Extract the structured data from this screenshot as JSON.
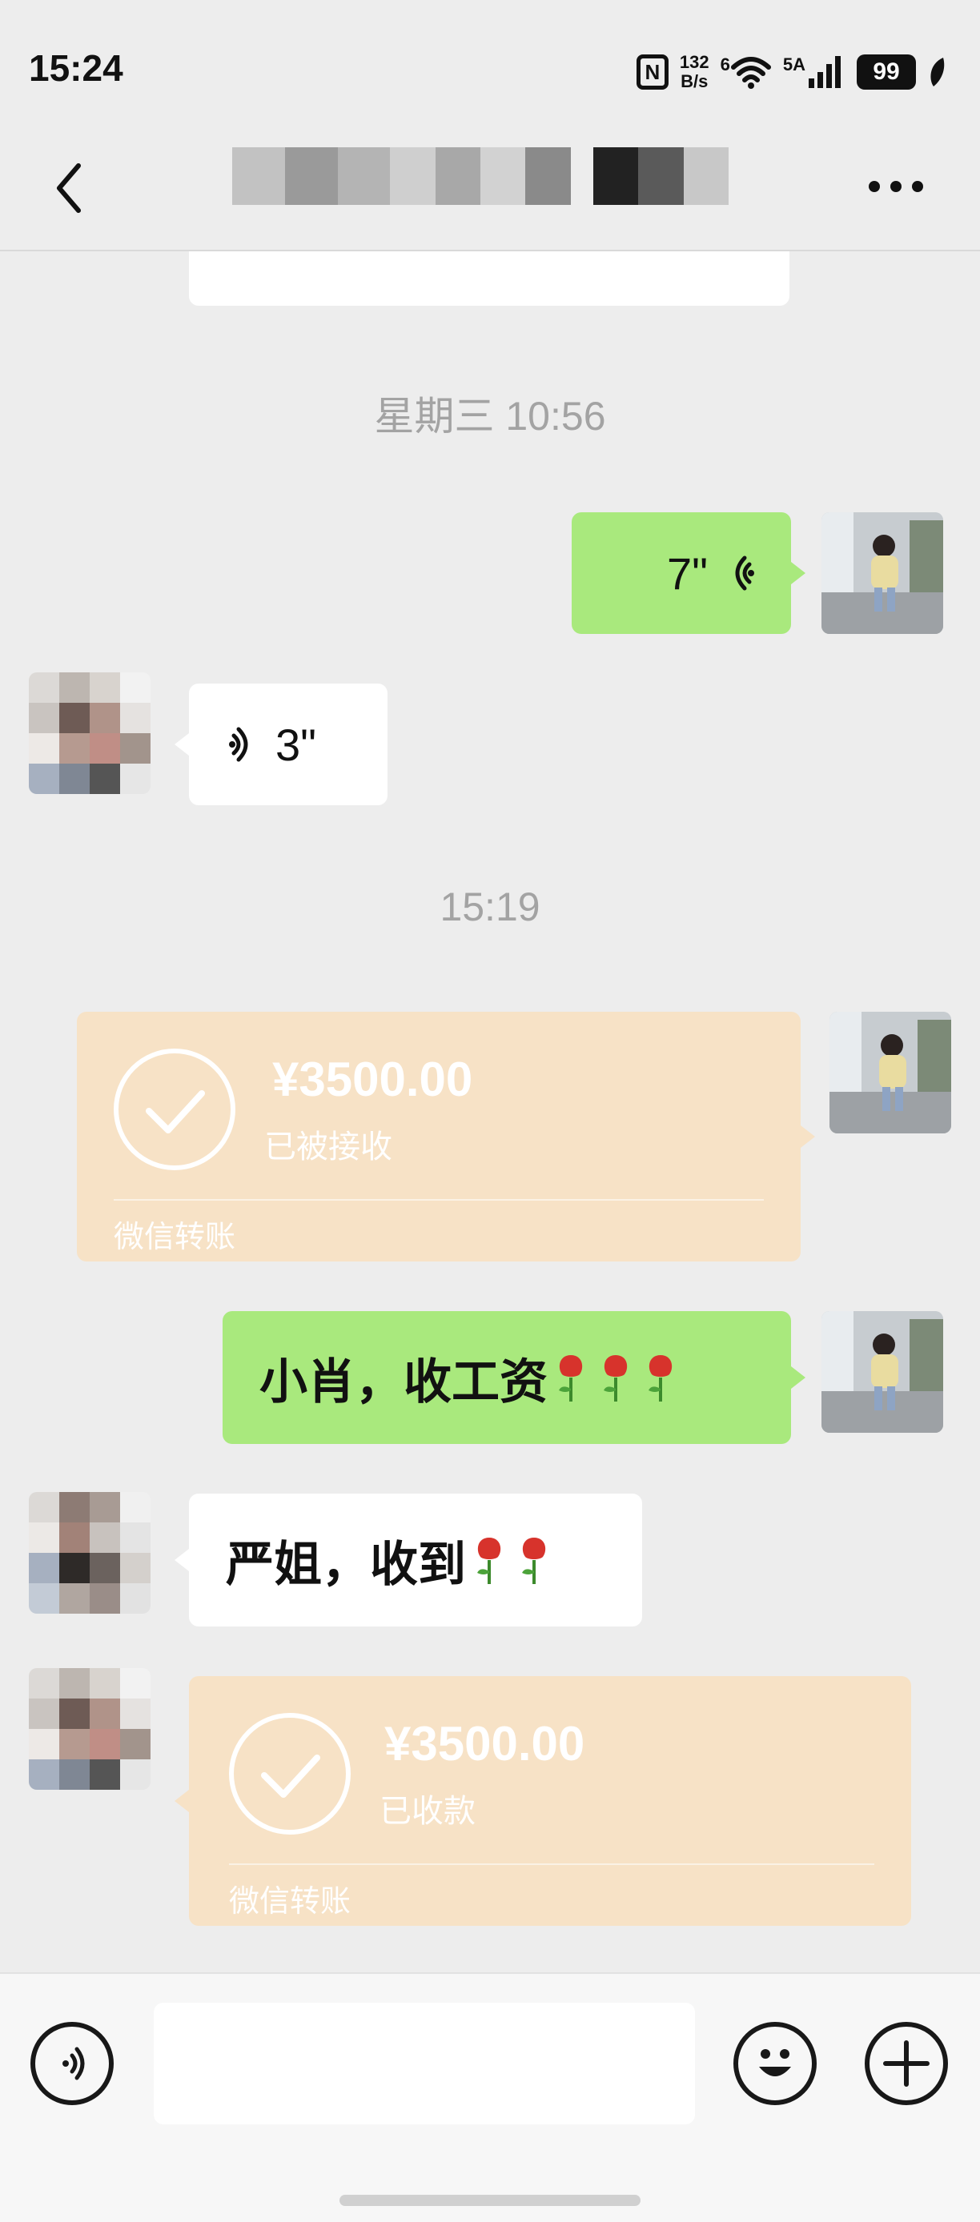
{
  "status_bar": {
    "time": "15:24",
    "nfc": "N",
    "speed_value": "132",
    "speed_unit": "B/s",
    "wifi_label": "6",
    "signal_label": "5A",
    "battery": "99"
  },
  "header": {
    "back_icon": "chevron-left-icon",
    "more_icon": "ellipsis-icon"
  },
  "messages": {
    "ts1": "星期三 10:56",
    "voice_sent": "7\"",
    "voice_recv": "3\"",
    "ts2": "15:19",
    "transfer1": {
      "amount": "¥3500.00",
      "status": "已被接收",
      "label": "微信转账"
    },
    "text_sent": "小肖，收工资",
    "text_recv": "严姐，收到",
    "transfer2": {
      "amount": "¥3500.00",
      "status": "已收款",
      "label": "微信转账"
    }
  },
  "input": {
    "placeholder": ""
  },
  "colors": {
    "background": "#ededed",
    "green_bubble": "#a9e97d",
    "transfer_bubble": "#f7e2c6",
    "white_bubble": "#ffffff"
  }
}
